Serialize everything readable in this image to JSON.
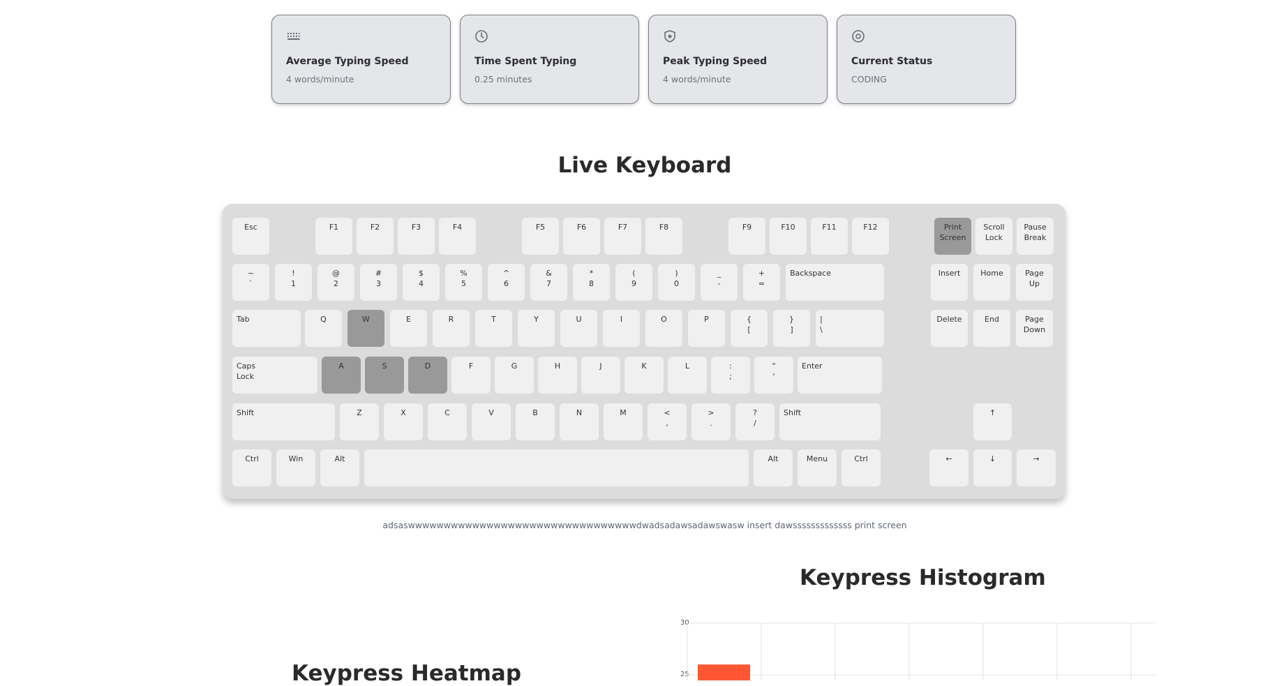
{
  "stats": [
    {
      "icon": "keyboard-icon",
      "title": "Average Typing Speed",
      "value": "4 words/minute"
    },
    {
      "icon": "clock-icon",
      "title": "Time Spent Typing",
      "value": "0.25 minutes"
    },
    {
      "icon": "shield-star-icon",
      "title": "Peak Typing Speed",
      "value": "4 words/minute"
    },
    {
      "icon": "eye-icon",
      "title": "Current Status",
      "value": "CODING"
    }
  ],
  "live_keyboard": {
    "title": "Live Keyboard",
    "pressed_keys": [
      "Print Screen",
      "W",
      "A",
      "S",
      "D"
    ],
    "rows": {
      "fn": [
        "Esc",
        "F1",
        "F2",
        "F3",
        "F4",
        "F5",
        "F6",
        "F7",
        "F8",
        "F9",
        "F10",
        "F11",
        "F12"
      ],
      "nav_top": [
        [
          "Print",
          "Screen"
        ],
        [
          "Scroll",
          "Lock"
        ],
        [
          "Pause",
          "Break"
        ]
      ],
      "number": [
        [
          "~",
          "`"
        ],
        [
          "!",
          "1"
        ],
        [
          "@",
          "2"
        ],
        [
          "#",
          "3"
        ],
        [
          "$",
          "4"
        ],
        [
          "%",
          "5"
        ],
        [
          "^",
          "6"
        ],
        [
          "&",
          "7"
        ],
        [
          "*",
          "8"
        ],
        [
          "(",
          "9"
        ],
        [
          ")",
          "0"
        ],
        [
          "_",
          "-"
        ],
        [
          "+",
          "="
        ],
        [
          "Backspace"
        ]
      ],
      "nav_mid": [
        [
          "Insert"
        ],
        [
          "Home"
        ],
        [
          "Page",
          "Up"
        ]
      ],
      "qwerty": [
        [
          "Tab"
        ],
        [
          "Q"
        ],
        [
          "W"
        ],
        [
          "E"
        ],
        [
          "R"
        ],
        [
          "T"
        ],
        [
          "Y"
        ],
        [
          "U"
        ],
        [
          "I"
        ],
        [
          "O"
        ],
        [
          "P"
        ],
        [
          "{",
          "["
        ],
        [
          "}",
          "]"
        ],
        [
          "|",
          "\\"
        ]
      ],
      "nav_bot": [
        [
          "Delete"
        ],
        [
          "End"
        ],
        [
          "Page",
          "Down"
        ]
      ],
      "home": [
        [
          "Caps",
          "Lock"
        ],
        [
          "A"
        ],
        [
          "S"
        ],
        [
          "D"
        ],
        [
          "F"
        ],
        [
          "G"
        ],
        [
          "H"
        ],
        [
          "J"
        ],
        [
          "K"
        ],
        [
          "L"
        ],
        [
          ":",
          ";"
        ],
        [
          "\"",
          "'"
        ],
        [
          "Enter"
        ]
      ],
      "shift": [
        [
          "Shift"
        ],
        [
          "Z"
        ],
        [
          "X"
        ],
        [
          "C"
        ],
        [
          "V"
        ],
        [
          "B"
        ],
        [
          "N"
        ],
        [
          "M"
        ],
        [
          "<",
          ","
        ],
        [
          ">",
          "."
        ],
        [
          "?",
          "/"
        ],
        [
          "Shift"
        ]
      ],
      "bottom": [
        [
          "Ctrl"
        ],
        [
          "Win"
        ],
        [
          "Alt"
        ],
        [
          ""
        ],
        [
          "Alt"
        ],
        [
          "Menu"
        ],
        [
          "Ctrl"
        ]
      ],
      "arrows": [
        "↑",
        "←",
        "↓",
        "→"
      ]
    }
  },
  "typed_text": "adsaswwwwwwwwwwwwwwwwwwwwwwwwwwwwwwwwdwadsadawsadawswasw insert dawsssssssssssss print screen",
  "histogram": {
    "title": "Keypress Histogram",
    "accent": "#ff5733",
    "chart_data": {
      "type": "bar",
      "ylim": [
        0,
        30
      ],
      "yticks": [
        30,
        25
      ],
      "values": [
        26
      ]
    }
  },
  "heatmap": {
    "title": "Keypress Heatmap"
  }
}
